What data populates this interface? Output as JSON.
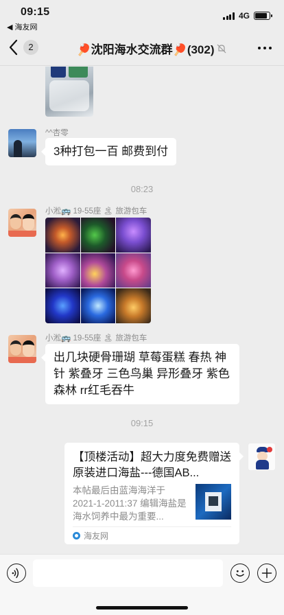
{
  "status": {
    "time": "09:15",
    "back_label": "◀ 海友网",
    "network": "4G",
    "battery_level": 0.85
  },
  "nav": {
    "unread_count": "2",
    "title": "🏓沈阳海水交流群🏓(302)"
  },
  "messages": [
    {
      "type": "image",
      "icon": "bottles-photo"
    },
    {
      "type": "text",
      "sender": "^^杏零",
      "text": "3种打包一百  邮费到付"
    },
    {
      "type": "timestamp",
      "text": "08:23"
    },
    {
      "type": "image-grid",
      "sender": "小淞🚌 19-55座 🏝 旅游包车",
      "cells": 9
    },
    {
      "type": "text",
      "sender": "小淞🚌 19-55座 🏝 旅游包车",
      "text": "出几块硬骨珊瑚 草莓蛋糕 春热 神针 紫叠牙 三色鸟巢 异形叠牙 紫色森林 rr红毛吞牛"
    },
    {
      "type": "timestamp",
      "text": "09:15"
    },
    {
      "type": "link-card",
      "title": "【顶楼活动】超大力度免费赠送原装进口海盐---德国AB...",
      "desc": "本帖最后由蓝海海洋于 2021-1-2011:37 编辑海盐是海水饲养中最为重要...",
      "source": "海友网"
    }
  ],
  "icons": {
    "back": "chevron-left-icon",
    "mute": "bell-muted-icon",
    "more": "more-dots-icon",
    "voice": "voice-icon",
    "emoji": "emoji-icon",
    "plus": "plus-icon"
  }
}
